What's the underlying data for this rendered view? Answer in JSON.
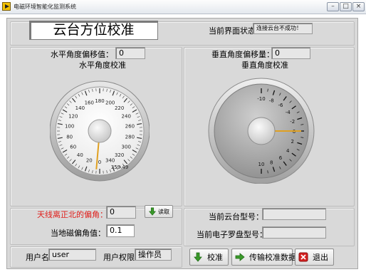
{
  "window": {
    "title": "电磁环境智能化监测系统"
  },
  "header": {
    "title": "云台方位校准",
    "status_label": "当前界面状态",
    "status_value": "连接云台不成功！"
  },
  "horizontal": {
    "offset_label": "水平角度偏移值：",
    "offset_value": "0",
    "gauge_title": "水平角度校准",
    "ticks": [
      "0",
      "20",
      "40",
      "60",
      "80",
      "100",
      "120",
      "140",
      "160",
      "180",
      "200",
      "220",
      "240",
      "260",
      "280",
      "300",
      "320",
      "340"
    ],
    "end_label": "359.49",
    "needle_value": 5
  },
  "vertical": {
    "offset_label": "垂直角度偏移量：",
    "offset_value": "0",
    "gauge_title": "垂直角度校准",
    "ticks": [
      "-10",
      "-8",
      "-6",
      "-4",
      "-2",
      "0",
      "2",
      "4",
      "6",
      "8",
      "10"
    ],
    "needle_value": 0
  },
  "declination": {
    "north_label": "天线离正北的偏角：",
    "north_value": "0",
    "read_button": "读取",
    "mag_label": "当地磁偏角值：",
    "mag_value": "0.1",
    "north_label_color": "#e0201c"
  },
  "user": {
    "name_label": "用户名",
    "name_value": "user",
    "perm_label": "用户权限",
    "perm_value": "操作员"
  },
  "device": {
    "ptz_label": "当前云台型号：",
    "ptz_value": "",
    "compass_label": "当前电子罗盘型号：",
    "compass_value": ""
  },
  "actions": {
    "calibrate": "校准",
    "transfer": "传输校准数据",
    "exit": "退出"
  },
  "colors": {
    "needle": "#e0a020",
    "frame": "#d9d9d9",
    "accent_green": "#3a9a2a",
    "exit_red": "#d52020"
  }
}
